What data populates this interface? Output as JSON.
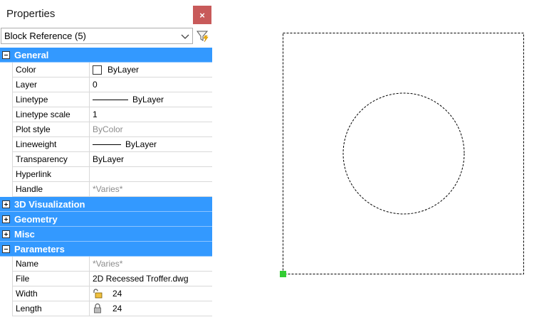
{
  "panel": {
    "title": "Properties",
    "close_glyph": "×",
    "selector": {
      "value": "Block Reference (5)"
    }
  },
  "categories": {
    "general": "General",
    "viz3d": "3D Visualization",
    "geometry": "Geometry",
    "misc": "Misc",
    "parameters": "Parameters"
  },
  "general": [
    {
      "name": "Color",
      "value": "ByLayer"
    },
    {
      "name": "Layer",
      "value": "0"
    },
    {
      "name": "Linetype",
      "value": "ByLayer"
    },
    {
      "name": "Linetype scale",
      "value": "1"
    },
    {
      "name": "Plot style",
      "value": "ByColor"
    },
    {
      "name": "Lineweight",
      "value": "ByLayer"
    },
    {
      "name": "Transparency",
      "value": "ByLayer"
    },
    {
      "name": "Hyperlink",
      "value": ""
    },
    {
      "name": "Handle",
      "value": "*Varies*"
    }
  ],
  "parameters": [
    {
      "name": "Name",
      "value": "*Varies*"
    },
    {
      "name": "File",
      "value": "2D Recessed Troffer.dwg"
    },
    {
      "name": "Width",
      "value": "24"
    },
    {
      "name": "Length",
      "value": "24"
    }
  ],
  "colors": {
    "category_bg": "#3399ff",
    "close_bg": "#c85a5a",
    "grip": "#33cc33"
  }
}
